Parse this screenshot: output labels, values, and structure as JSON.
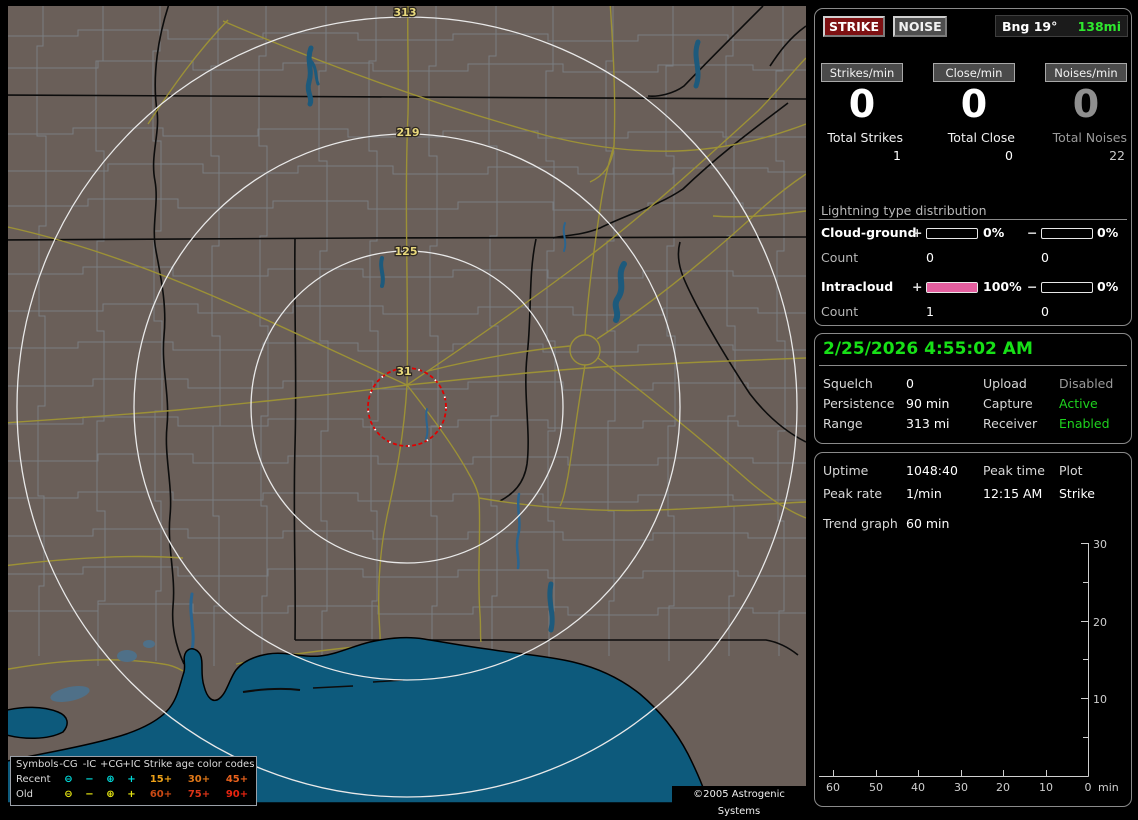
{
  "header": {
    "strike_button": "STRIKE",
    "noise_button": "NOISE",
    "bearing": "Bng 19°",
    "distance": "138mi",
    "distance_color": "#2ee82e"
  },
  "counters": {
    "columns": [
      {
        "label": "Strikes/min",
        "rate": "0",
        "total_label": "Total Strikes",
        "total_value": "1"
      },
      {
        "label": "Close/min",
        "rate": "0",
        "total_label": "Total Close",
        "total_value": "0"
      },
      {
        "label": "Noises/min",
        "rate": "0",
        "total_label": "Total Noises",
        "total_value": "22"
      }
    ]
  },
  "distribution": {
    "title": "Lightning type distribution",
    "bar_fill_color": "#e45f9f",
    "rows": [
      {
        "label": "Cloud-ground",
        "plus_sign": "+",
        "plus_pct": "0%",
        "plus_fill": "0%",
        "minus_sign": "−",
        "minus_pct": "0%",
        "minus_fill": "0%",
        "count_label": "Count",
        "plus_count": "0",
        "minus_count": "0"
      },
      {
        "label": "Intracloud",
        "plus_sign": "+",
        "plus_pct": "100%",
        "plus_fill": "100%",
        "minus_sign": "−",
        "minus_pct": "0%",
        "minus_fill": "0%",
        "count_label": "Count",
        "plus_count": "1",
        "minus_count": "0"
      }
    ]
  },
  "status": {
    "datetime": "2/25/2026 4:55:02 AM",
    "datetime_color": "#17e017",
    "rows": [
      {
        "l1": "Squelch",
        "v1": "0",
        "l2": "Upload",
        "v2": "Disabled",
        "v2_color": "#9a9a9a"
      },
      {
        "l1": "Persistence",
        "v1": "90 min",
        "l2": "Capture",
        "v2": "Active",
        "v2_color": "#1ed31e"
      },
      {
        "l1": "Range",
        "v1": "313 mi",
        "l2": "Receiver",
        "v2": "Enabled",
        "v2_color": "#1ed31e"
      }
    ]
  },
  "stats": {
    "uptime_label": "Uptime",
    "uptime": "1048:40",
    "peak_time_label": "Peak time",
    "plot_label": "Plot",
    "peak_rate_label": "Peak rate",
    "peak_rate": "1/min",
    "peak_time": "12:15 AM",
    "plot_value": "Strike",
    "trend_label": "Trend graph",
    "trend_window": "60 min"
  },
  "chart_data": {
    "type": "line",
    "title": "Trend graph (60 min)",
    "x_tick_labels": [
      "60",
      "50",
      "40",
      "30",
      "20",
      "10",
      "0"
    ],
    "x_unit": "min",
    "y_tick_labels": [
      "30",
      "20",
      "10"
    ],
    "y_range": [
      0,
      30
    ],
    "x_range": [
      60,
      0
    ],
    "grid": false,
    "axis_color": "#cfcfcf",
    "series": []
  },
  "map": {
    "ring_labels": [
      "313",
      "219",
      "125",
      "31"
    ],
    "rings_mi": [
      313,
      219,
      125,
      31
    ],
    "range_ring_color": "#e9e9e9",
    "close_ring_color": "#e00000",
    "ring_label_color": "#e8d87c",
    "land_color": "#6a5f59",
    "water_color": "#0d5a7c",
    "copyright": "©2005 Astrogenic Systems",
    "legend": {
      "col_headers": [
        "Symbols",
        "-CG",
        "-IC",
        "+CG",
        "+IC"
      ],
      "age_header": "Strike age color codes",
      "rows": [
        {
          "label": "Recent",
          "color": "#00dcdc",
          "symbols": [
            "⊖",
            "−",
            "⊕",
            "+"
          ],
          "ages": [
            {
              "text": "15+",
              "color": "#eda117"
            },
            {
              "text": "30+",
              "color": "#e07818"
            },
            {
              "text": "45+",
              "color": "#e8611c"
            }
          ]
        },
        {
          "label": "Old",
          "color": "#e3e312",
          "symbols": [
            "⊖",
            "−",
            "⊕",
            "+"
          ],
          "ages": [
            {
              "text": "60+",
              "color": "#cc4a14"
            },
            {
              "text": "75+",
              "color": "#dc3418"
            },
            {
              "text": "90+",
              "color": "#ea2410"
            }
          ]
        }
      ]
    }
  }
}
